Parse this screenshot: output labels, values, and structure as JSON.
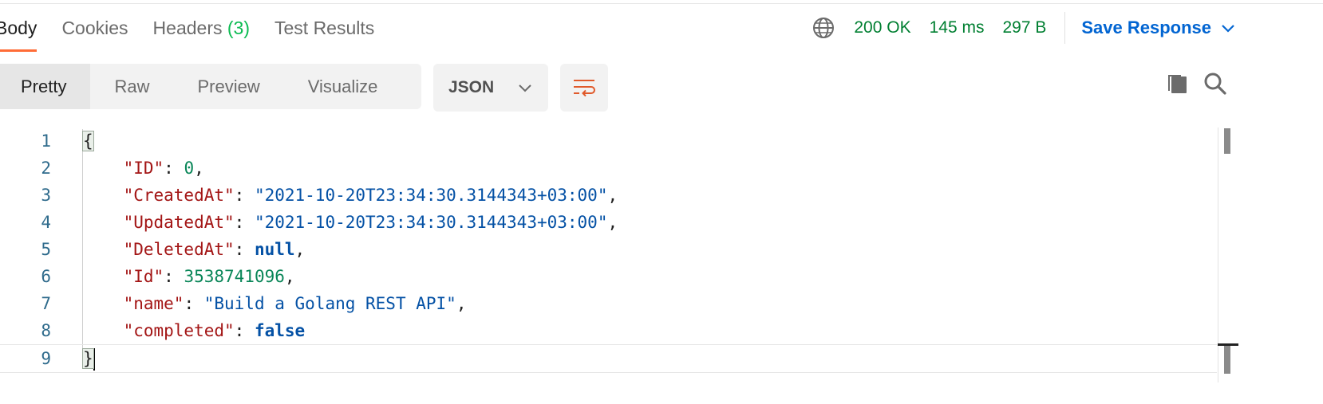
{
  "tabs": [
    {
      "label": "Body",
      "active": true
    },
    {
      "label": "Cookies"
    },
    {
      "label": "Headers",
      "count": "(3)"
    },
    {
      "label": "Test Results"
    }
  ],
  "status": {
    "code": "200 OK",
    "time": "145 ms",
    "size": "297 B",
    "save_label": "Save Response"
  },
  "views": [
    "Pretty",
    "Raw",
    "Preview",
    "Visualize"
  ],
  "format": "JSON",
  "code_lines": [
    {
      "n": "1",
      "parts": [
        {
          "t": "{",
          "c": "brace"
        }
      ]
    },
    {
      "n": "2",
      "parts": [
        {
          "t": "    "
        },
        {
          "t": "\"ID\"",
          "c": "k"
        },
        {
          "t": ": ",
          "c": "p"
        },
        {
          "t": "0",
          "c": "n"
        },
        {
          "t": ",",
          "c": "p"
        }
      ]
    },
    {
      "n": "3",
      "parts": [
        {
          "t": "    "
        },
        {
          "t": "\"CreatedAt\"",
          "c": "k"
        },
        {
          "t": ": ",
          "c": "p"
        },
        {
          "t": "\"2021-10-20T23:34:30.3144343+03:00\"",
          "c": "s"
        },
        {
          "t": ",",
          "c": "p"
        }
      ]
    },
    {
      "n": "4",
      "parts": [
        {
          "t": "    "
        },
        {
          "t": "\"UpdatedAt\"",
          "c": "k"
        },
        {
          "t": ": ",
          "c": "p"
        },
        {
          "t": "\"2021-10-20T23:34:30.3144343+03:00\"",
          "c": "s"
        },
        {
          "t": ",",
          "c": "p"
        }
      ]
    },
    {
      "n": "5",
      "parts": [
        {
          "t": "    "
        },
        {
          "t": "\"DeletedAt\"",
          "c": "k"
        },
        {
          "t": ": ",
          "c": "p"
        },
        {
          "t": "null",
          "c": "kw"
        },
        {
          "t": ",",
          "c": "p"
        }
      ]
    },
    {
      "n": "6",
      "parts": [
        {
          "t": "    "
        },
        {
          "t": "\"Id\"",
          "c": "k"
        },
        {
          "t": ": ",
          "c": "p"
        },
        {
          "t": "3538741096",
          "c": "n"
        },
        {
          "t": ",",
          "c": "p"
        }
      ]
    },
    {
      "n": "7",
      "parts": [
        {
          "t": "    "
        },
        {
          "t": "\"name\"",
          "c": "k"
        },
        {
          "t": ": ",
          "c": "p"
        },
        {
          "t": "\"Build a Golang REST API\"",
          "c": "s"
        },
        {
          "t": ",",
          "c": "p"
        }
      ]
    },
    {
      "n": "8",
      "parts": [
        {
          "t": "    "
        },
        {
          "t": "\"completed\"",
          "c": "k"
        },
        {
          "t": ": ",
          "c": "p"
        },
        {
          "t": "false",
          "c": "kw"
        }
      ]
    },
    {
      "n": "9",
      "parts": [
        {
          "t": "}",
          "c": "brace"
        }
      ],
      "current": true
    }
  ],
  "colors": {
    "accent": "#ff6c37",
    "status_green": "#007f31",
    "link_blue": "#0265d2"
  },
  "icons": [
    "globe-icon",
    "chevron-down-icon",
    "wrap-lines-icon",
    "copy-icon",
    "search-icon"
  ]
}
